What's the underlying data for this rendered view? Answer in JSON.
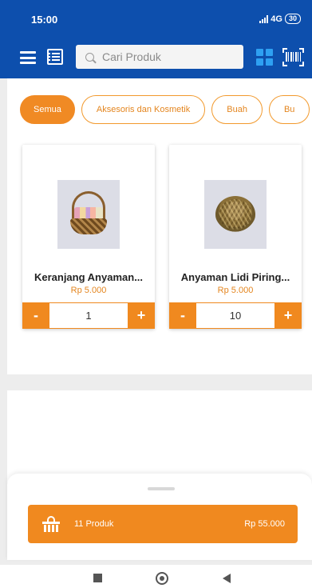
{
  "status_bar": {
    "time": "15:00",
    "network": "4G",
    "battery": "30"
  },
  "toolbar": {
    "search_placeholder": "Cari Produk",
    "icons": [
      "menu-icon",
      "list-icon",
      "search-icon",
      "grid-icon",
      "barcode-icon"
    ]
  },
  "categories": [
    {
      "label": "Semua",
      "active": true
    },
    {
      "label": "Aksesoris dan Kosmetik",
      "active": false
    },
    {
      "label": "Buah",
      "active": false
    },
    {
      "label": "Bu",
      "active": false
    }
  ],
  "products": [
    {
      "name": "Keranjang Anyaman...",
      "price": "Rp 5.000",
      "qty": "1",
      "image": "basket"
    },
    {
      "name": "Anyaman Lidi Piring...",
      "price": "Rp 5.000",
      "qty": "10",
      "image": "bowl"
    }
  ],
  "qty_controls": {
    "minus": "-",
    "plus": "+"
  },
  "cart": {
    "count_label": "11 Produk",
    "total": "Rp 55.000"
  },
  "colors": {
    "header": "#0d4fad",
    "accent": "#f08a24",
    "grid_icon": "#2ea0f2"
  }
}
